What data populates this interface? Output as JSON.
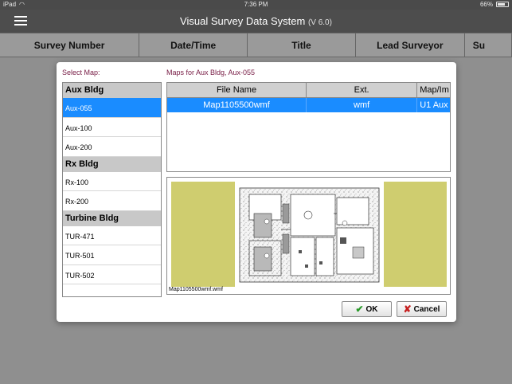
{
  "status_bar": {
    "carrier": "iPad",
    "wifi_icon": "wifi-icon",
    "time": "7:36 PM",
    "battery": "66%"
  },
  "app": {
    "title": "Visual Survey Data System",
    "version": "(V 6.0)"
  },
  "columns": [
    "Survey Number",
    "Date/Time",
    "Title",
    "Lead Surveyor",
    "Su"
  ],
  "dialog": {
    "select_map_label": "Select Map:",
    "maps_for_label": "Maps for Aux Bldg, Aux-055",
    "groups": [
      {
        "name": "Aux Bldg",
        "items": [
          "Aux-055",
          "Aux-100",
          "Aux-200"
        ]
      },
      {
        "name": "Rx Bldg",
        "items": [
          "Rx-100",
          "Rx-200"
        ]
      },
      {
        "name": "Turbine Bldg",
        "items": [
          "TUR-471",
          "TUR-501",
          "TUR-502"
        ]
      }
    ],
    "selected_item": "Aux-055",
    "file_table": {
      "headers": [
        "File Name",
        "Ext.",
        "Map/Im"
      ],
      "rows": [
        [
          "Map1105500wmf",
          "wmf",
          "U1 Aux"
        ]
      ]
    },
    "preview_caption": "Map1105500wmf.wmf",
    "ok_label": "OK",
    "cancel_label": "Cancel",
    "colors": {
      "selection": "#1a8cff",
      "accent_text": "#7a2048",
      "preview_panel": "#cfcd6f"
    }
  }
}
